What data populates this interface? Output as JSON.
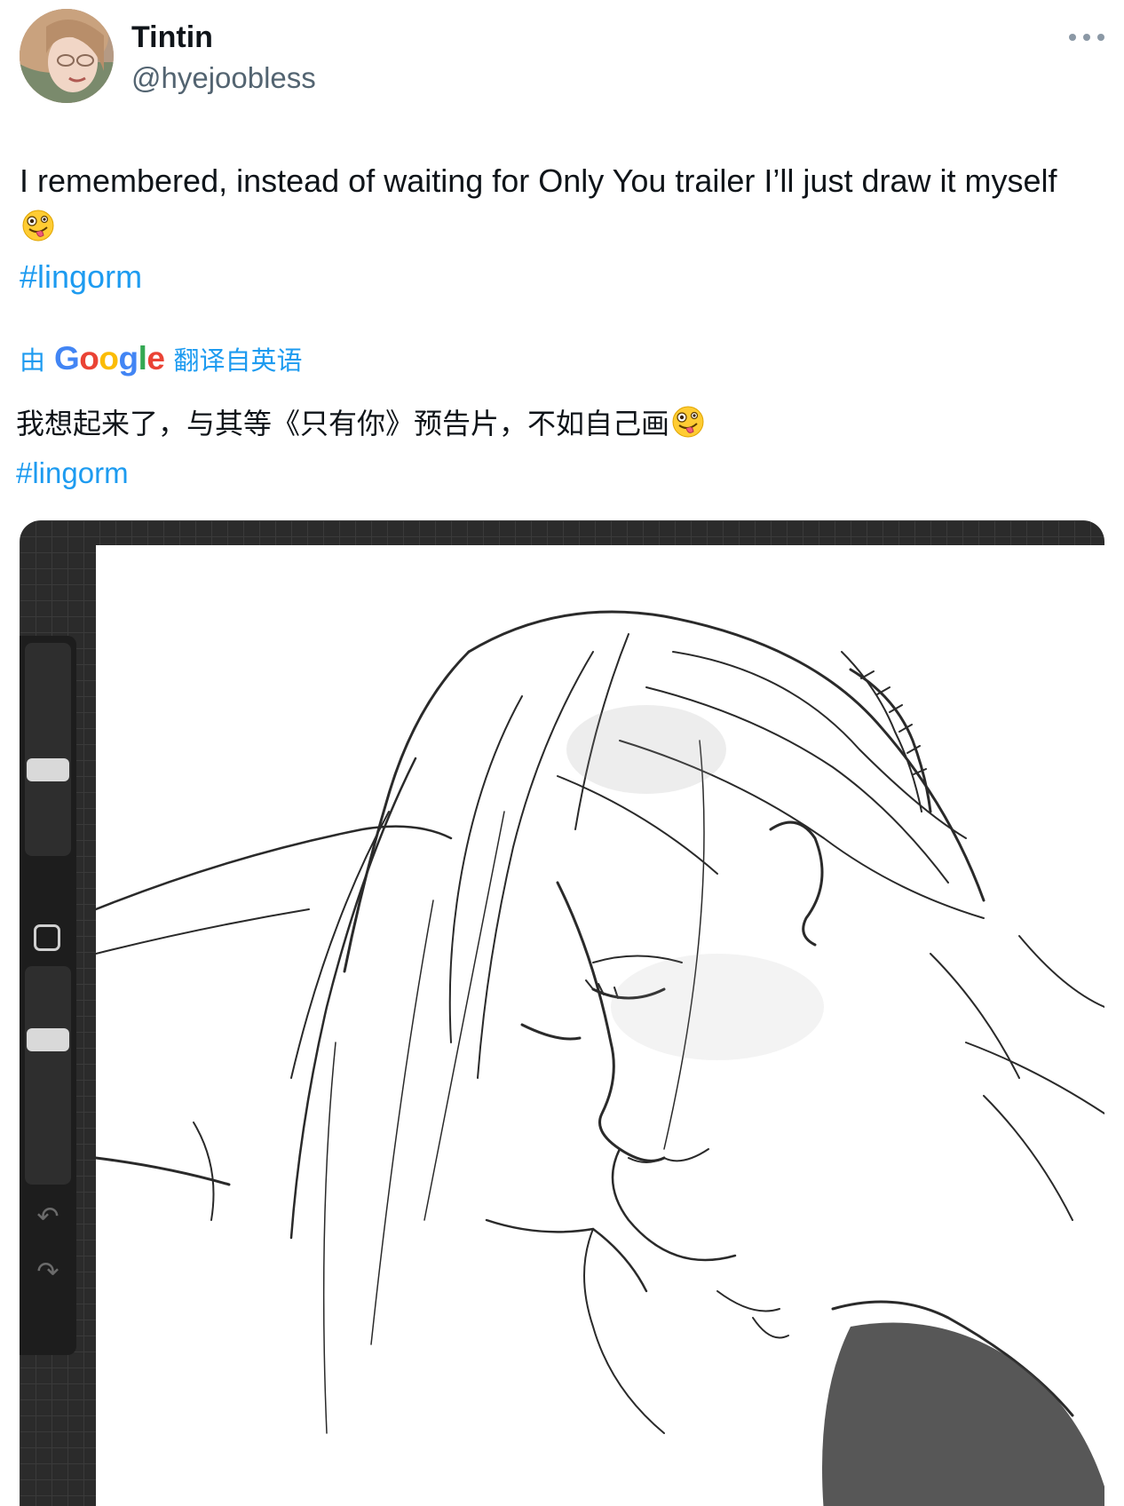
{
  "author": {
    "display_name": "Tintin",
    "handle": "@hyejoobless"
  },
  "tweet": {
    "text": "I remembered, instead of waiting for Only You trailer I’ll just draw it myself",
    "emoji": "zany-face",
    "hashtag": "#lingorm"
  },
  "translation": {
    "prefix": "由",
    "provider": "Google",
    "suffix": "翻译自英语",
    "text": "我想起来了，与其等《只有你》预告片，不如自己画",
    "hashtag": "#lingorm"
  },
  "media": {
    "description_icon": "drawing-app-canvas",
    "toolbar_icons": [
      "brush-size-slider",
      "modify-button-icon",
      "opacity-slider",
      "undo-icon",
      "redo-icon"
    ]
  },
  "colors": {
    "link": "#1d9bf0",
    "secondary_text": "#536471",
    "canvas_bg": "#ffffff",
    "app_chrome": "#2b2b2b"
  }
}
